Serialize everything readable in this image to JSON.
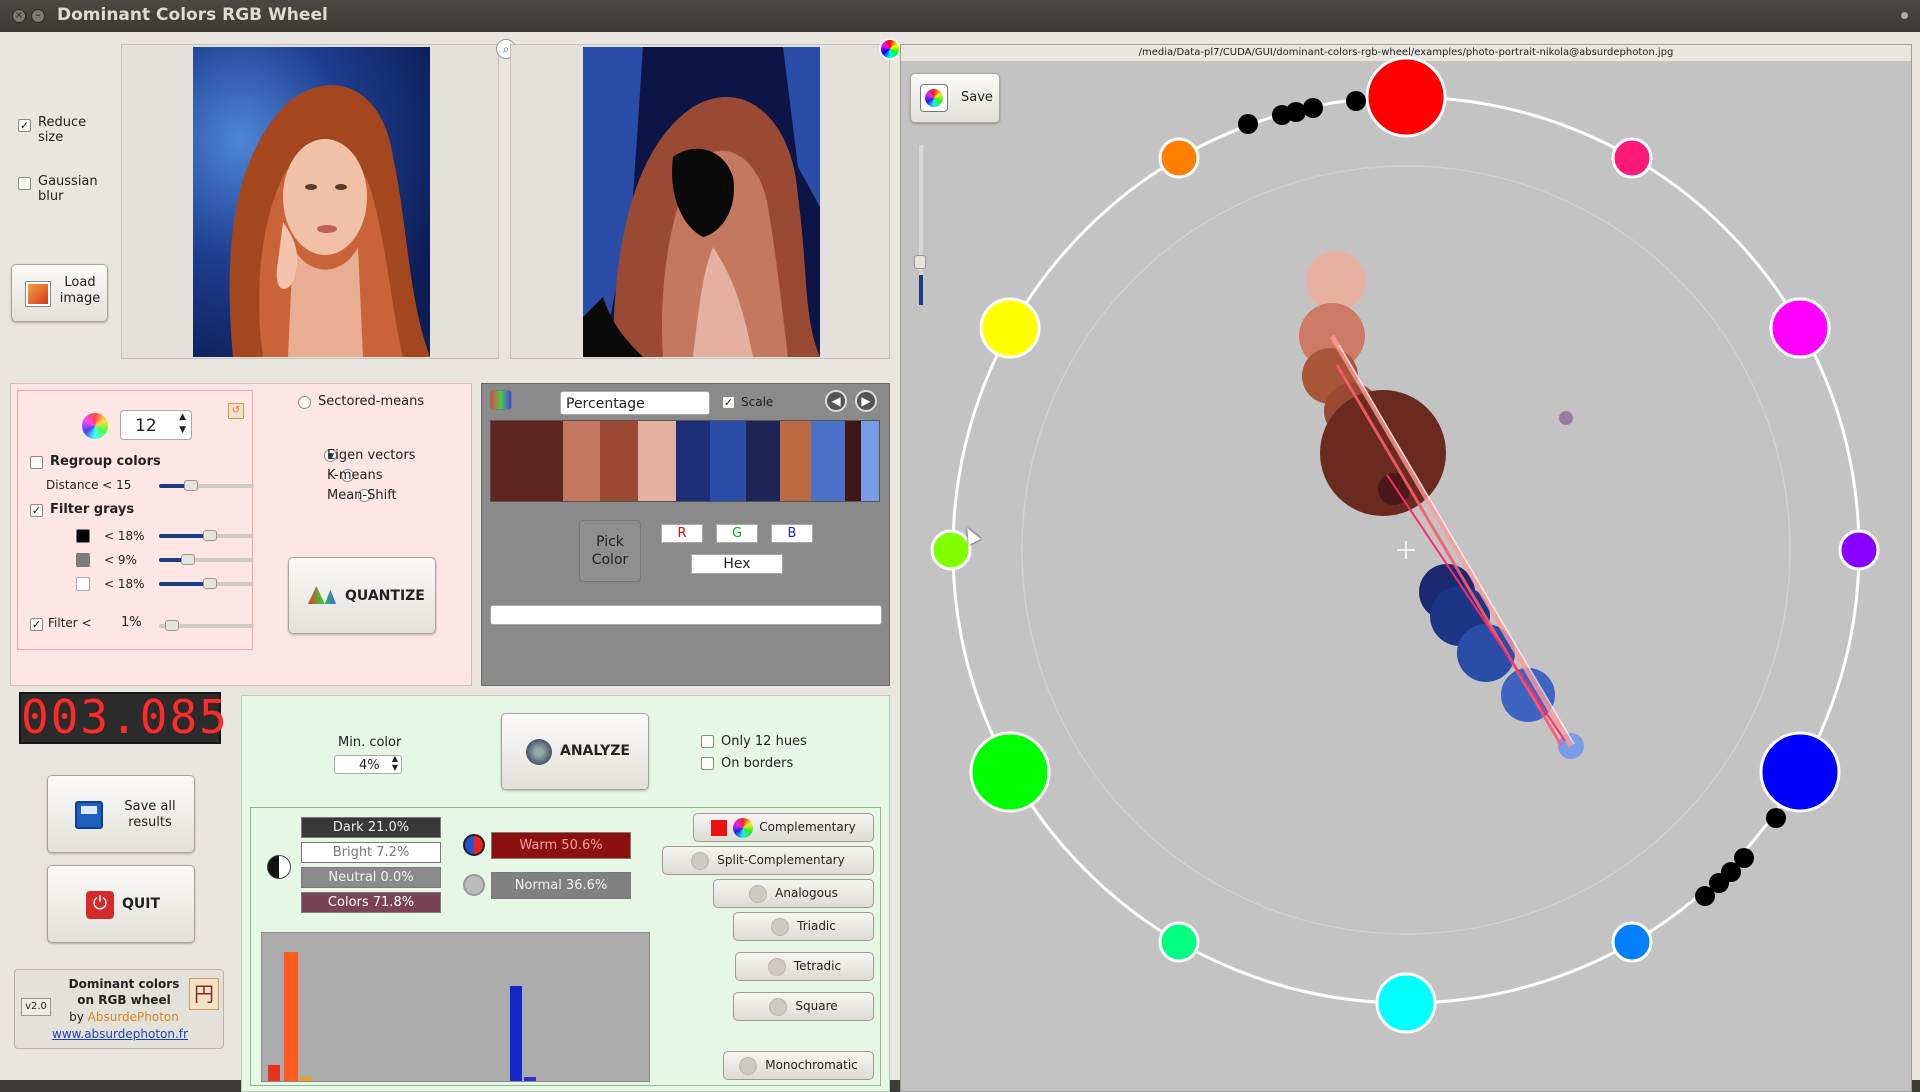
{
  "window": {
    "title": "Dominant Colors RGB Wheel"
  },
  "options": {
    "reduce_size": "Reduce size",
    "reduce_size_checked": true,
    "gaussian_blur": "Gaussian blur",
    "gaussian_blur_checked": false
  },
  "load_button": "Load image",
  "quantize": {
    "colors_count": "12",
    "regroup_label": "Regroup colors",
    "distance_label": "Distance  <  15",
    "filter_grays_label": "Filter grays",
    "gray_rows": [
      "<  18%",
      "<  9%",
      "<  18%"
    ],
    "filter_label": "Filter <",
    "filter_value": "1%",
    "methods": [
      "Sectored-means",
      "Eigen vectors",
      "K-means",
      "Mean-Shift"
    ],
    "selected_method": "Eigen vectors",
    "button": "QUANTIZE"
  },
  "palette": {
    "sort_mode": "Percentage",
    "scale_label": "Scale",
    "colors": [
      "#5e261d",
      "#c47860",
      "#9a4a32",
      "#e4b0a0",
      "#1c2e78",
      "#2a4ea8",
      "#1d2456",
      "#bb6a44",
      "#4a70c8",
      "#3e1616",
      "#7a9be8"
    ],
    "pick_color": "Pick Color",
    "r": "R",
    "g": "G",
    "b": "B",
    "hex": "Hex"
  },
  "timer": "003.085",
  "save_all": "Save all results",
  "quit": "QUIT",
  "about": {
    "version": "v2.0",
    "line1": "Dominant colors",
    "line2": "on RGB wheel",
    "by": "by",
    "author": "AbsurdePhoton",
    "site": "www.absurdephoton.fr"
  },
  "analyze": {
    "min_color_label": "Min. color",
    "min_color_value": "4%",
    "button": "ANALYZE",
    "only_12_hues": "Only 12 hues",
    "on_borders": "On borders"
  },
  "stats": {
    "dark": "Dark 21.0%",
    "bright": "Bright 7.2%",
    "neutral": "Neutral 0.0%",
    "colors": "Colors 71.8%",
    "warm": "Warm 50.6%",
    "normal": "Normal 36.6%"
  },
  "harmonies": [
    "Complementary",
    "Split-Complementary",
    "Analogous",
    "Triadic",
    "Tetradic",
    "Square",
    "Monochromatic"
  ],
  "histogram": {
    "bars": [
      {
        "color": "#e8311d",
        "value": 0.12
      },
      {
        "color": "#ff5a1f",
        "value": 0.95
      },
      {
        "color": "#e8a21f",
        "value": 0.03
      },
      {
        "color": "#1428c8",
        "value": 0.7
      },
      {
        "color": "#2a32d0",
        "value": 0.03
      }
    ]
  },
  "wheel": {
    "file_path": "/media/Data-pl7/CUDA/GUI/dominant-colors-rgb-wheel/examples/photo-portrait-nikola@absurdephoton.jpg",
    "save_label": "Save"
  },
  "colors": {
    "accent": "#1b3d80",
    "panel_pink": "#fde6e3",
    "panel_green": "#e6f7e6"
  }
}
